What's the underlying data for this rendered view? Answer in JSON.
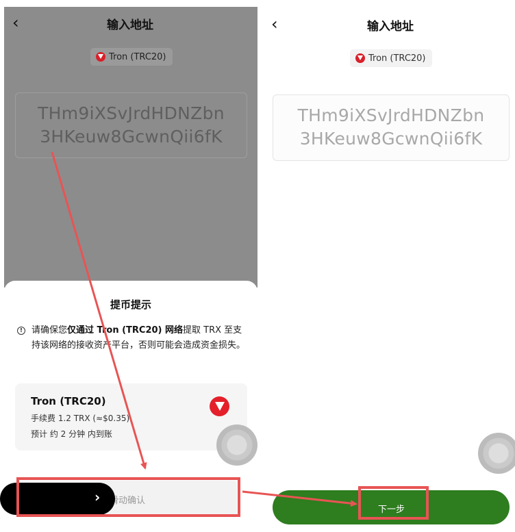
{
  "colors": {
    "annotation": "#e85454",
    "next_button": "#2e7d1f",
    "tron_red": "#e4202a",
    "dim_overlay": "#8c8c8c"
  },
  "left": {
    "header": {
      "back_icon": "‹",
      "title": "输入地址"
    },
    "network_chip": {
      "label": "Tron (TRC20)"
    },
    "address": {
      "line1": "THm9iXSvJrdHDNZbn",
      "line2": "3HKeuw8GcwnQii6fK"
    },
    "sheet": {
      "title": "提币提示",
      "warning_prefix": "请确保您",
      "warning_bold": "仅通过 Tron (TRC20) 网络",
      "warning_suffix": "提取 TRX 至支持该网络的接收资产平台，否则可能会造成资金损失。",
      "network_name": "Tron (TRC20)",
      "fee": "手续费 1.2 TRX (≈$0.35)",
      "eta": "预计 约 2 分钟 内到账"
    },
    "slider": {
      "label": "滑动确认",
      "thumb_icon": "›"
    }
  },
  "right": {
    "header": {
      "back_icon": "‹",
      "title": "输入地址"
    },
    "network_chip": {
      "label": "Tron (TRC20)"
    },
    "address": {
      "line1": "THm9iXSvJrdHDNZbn",
      "line2": "3HKeuw8GcwnQii6fK"
    },
    "next_button": {
      "label": "下一步"
    }
  }
}
